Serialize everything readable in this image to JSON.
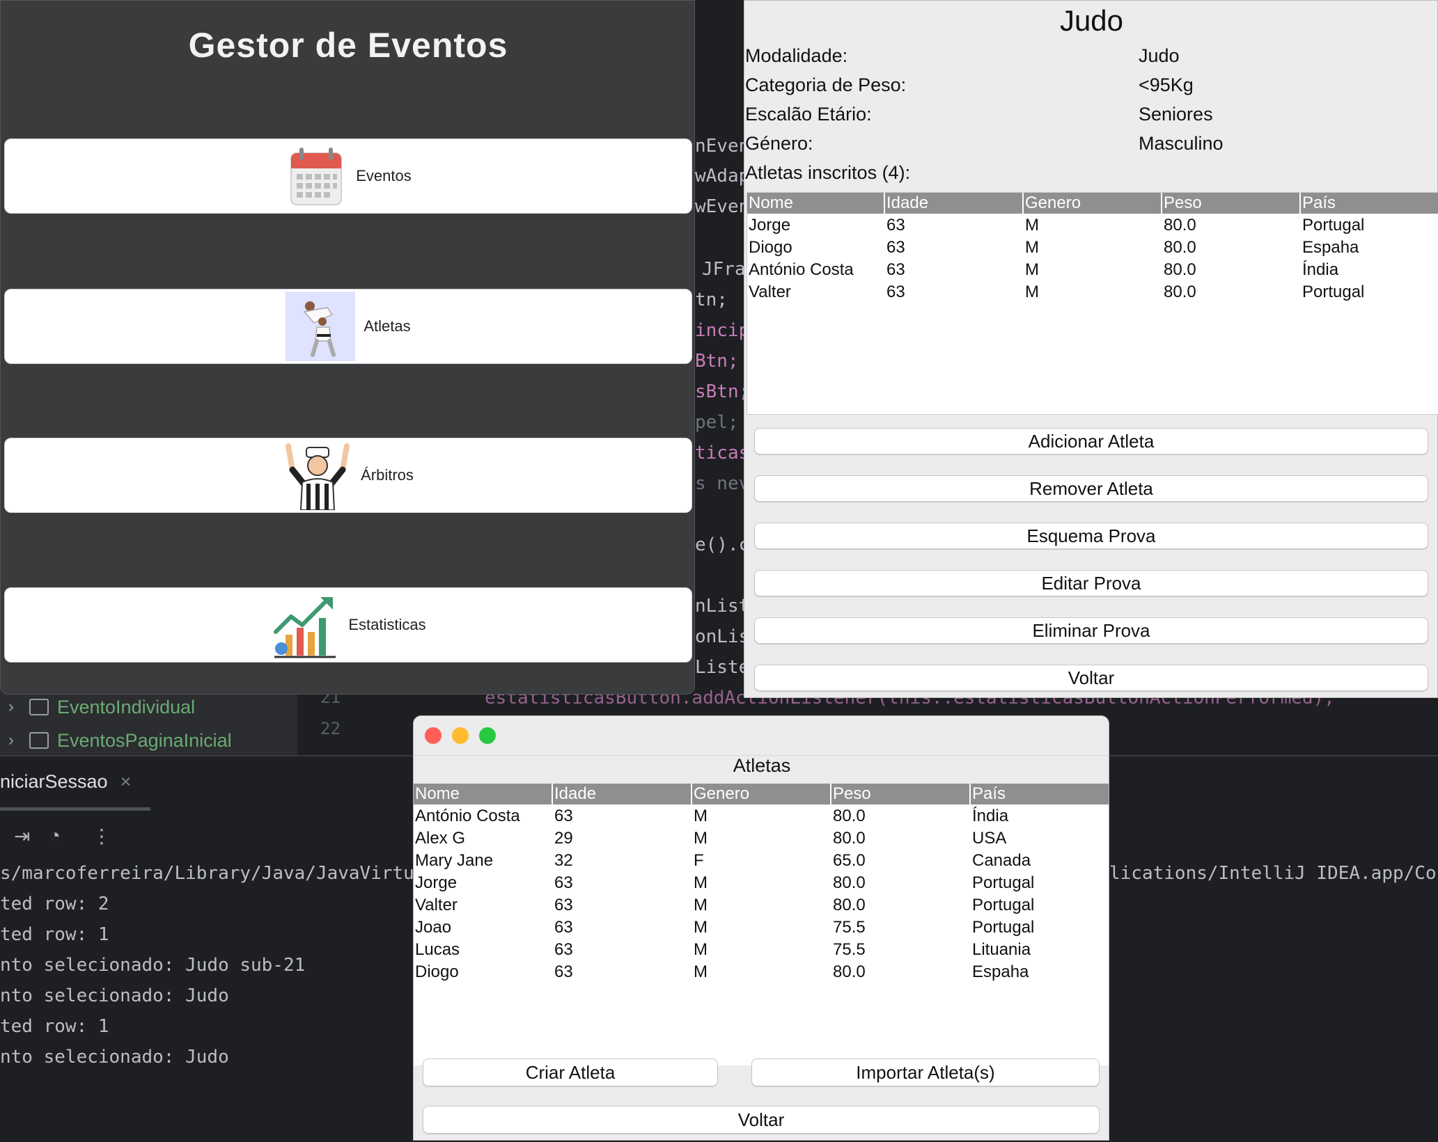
{
  "ide": {
    "tree_items": [
      {
        "label": "EventoIndividual"
      },
      {
        "label": "EventosPaginaInicial"
      }
    ],
    "line_numbers": [
      "21",
      "22"
    ],
    "code_fragments": [
      "nEven",
      "wAdap",
      "wEven",
      "JFra",
      "tn;",
      "incip",
      "Btn;",
      "sBtn;",
      "pel;",
      "ticas",
      "s nev",
      "e().c",
      "nList",
      "onLis",
      "Liste",
      "estatisticasButton.addActionListener(this::estatisticasButtonActionPerformed);"
    ],
    "run_tab": "niciarSessao",
    "console_lines": [
      "s/marcoferreira/Library/Java/JavaVirtu",
      "ted row: 2",
      "ted row: 1",
      "nto selecionado: Judo sub-21",
      "nto selecionado: Judo",
      "ted row: 1",
      "nto selecionado: Judo"
    ],
    "console_right": "lications/IntelliJ IDEA.app/Co"
  },
  "gestor": {
    "title": "Gestor de Eventos",
    "buttons": [
      {
        "label": "Eventos",
        "icon": "calendar-icon"
      },
      {
        "label": "Atletas",
        "icon": "judo-athletes-icon"
      },
      {
        "label": "Árbitros",
        "icon": "referee-icon"
      },
      {
        "label": "Estatisticas",
        "icon": "statistics-chart-icon"
      }
    ]
  },
  "judo": {
    "title": "Judo",
    "fields": [
      {
        "label": "Modalidade:",
        "value": "Judo"
      },
      {
        "label": "Categoria de Peso:",
        "value": "<95Kg"
      },
      {
        "label": "Escalão Etário:",
        "value": "Seniores"
      },
      {
        "label": "Género:",
        "value": "Masculino"
      }
    ],
    "enrolled_label": "Atletas inscritos (4):",
    "columns": [
      "Nome",
      "Idade",
      "Genero",
      "Peso",
      "País"
    ],
    "rows": [
      [
        "Jorge",
        "63",
        "M",
        "80.0",
        "Portugal"
      ],
      [
        "Diogo",
        "63",
        "M",
        "80.0",
        "Espaha"
      ],
      [
        "António Costa",
        "63",
        "M",
        "80.0",
        "Índia"
      ],
      [
        "Valter",
        "63",
        "M",
        "80.0",
        "Portugal"
      ]
    ],
    "buttons": [
      "Adicionar Atleta",
      "Remover Atleta",
      "Esquema Prova",
      "Editar Prova",
      "Eliminar Prova",
      "Voltar"
    ]
  },
  "atletas": {
    "title": "Atletas",
    "columns": [
      "Nome",
      "Idade",
      "Genero",
      "Peso",
      "País"
    ],
    "rows": [
      [
        "António Costa",
        "63",
        "M",
        "80.0",
        "Índia"
      ],
      [
        "Alex G",
        "29",
        "M",
        "80.0",
        "USA"
      ],
      [
        "Mary Jane",
        "32",
        "F",
        "65.0",
        "Canada"
      ],
      [
        "Jorge",
        "63",
        "M",
        "80.0",
        "Portugal"
      ],
      [
        "Valter",
        "63",
        "M",
        "80.0",
        "Portugal"
      ],
      [
        "Joao",
        "63",
        "M",
        "75.5",
        "Portugal"
      ],
      [
        "Lucas",
        "63",
        "M",
        "75.5",
        "Lituania"
      ],
      [
        "Diogo",
        "63",
        "M",
        "80.0",
        "Espaha"
      ]
    ],
    "create_label": "Criar Atleta",
    "import_label": "Importar Atleta(s)",
    "back_label": "Voltar"
  },
  "colors": {
    "traffic_close": "#ff5f57",
    "traffic_minimize": "#febc2e",
    "traffic_zoom": "#28c840",
    "table_header": "#8f8f8f",
    "gestor_bg": "#3a3b3d"
  }
}
